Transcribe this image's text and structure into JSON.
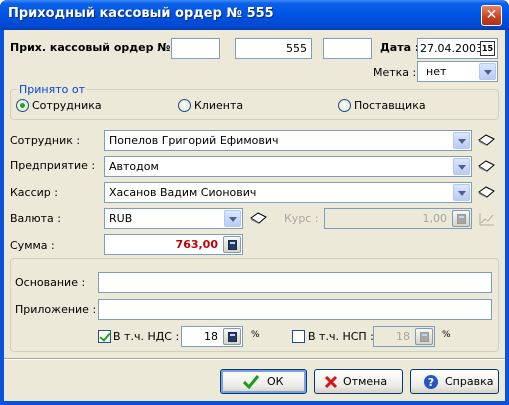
{
  "window": {
    "title": "Приходный кассовый ордер № 555",
    "close_glyph": "✕"
  },
  "header": {
    "order_label": "Прих. кассовый ордер №  :",
    "order_prefix": "",
    "order_number": "555",
    "order_suffix": "",
    "date_label": "Дата :",
    "date_value": "27.04.2003",
    "date_btn": "15",
    "mark_label": "Метка :",
    "mark_value": "нет"
  },
  "received_from": {
    "legend": "Принято от",
    "options": [
      "Сотрудника",
      "Клиента",
      "Поставщика"
    ],
    "selected": "Сотрудника"
  },
  "fields": {
    "employee_label": "Сотрудник :",
    "employee_value": "Попелов Григорий Ефимович",
    "company_label": "Предприятие :",
    "company_value": "Автодом",
    "cashier_label": "Кассир :",
    "cashier_value": "Хасанов Вадим Сионович",
    "currency_label": "Валюта :",
    "currency_value": "RUB",
    "rate_label": "Курс :",
    "rate_value": "1,00",
    "sum_label": "Сумма :",
    "sum_value": "763,00"
  },
  "details": {
    "basis_label": "Основание :",
    "basis_value": "",
    "attachment_label": "Приложение :",
    "attachment_value": "",
    "vat_label": "В т.ч. НДС :",
    "vat_value": "18",
    "vat_checked": true,
    "nsp_label": "В т.ч. НСП :",
    "nsp_value": "18",
    "nsp_checked": false,
    "percent": "%"
  },
  "buttons": {
    "ok": "ОК",
    "cancel": "Отмена",
    "help": "Справка"
  },
  "colors": {
    "title_bar": "#0055e5",
    "sum_text": "#c00000",
    "group_legend": "#0046d5",
    "face": "#ece9d8"
  }
}
